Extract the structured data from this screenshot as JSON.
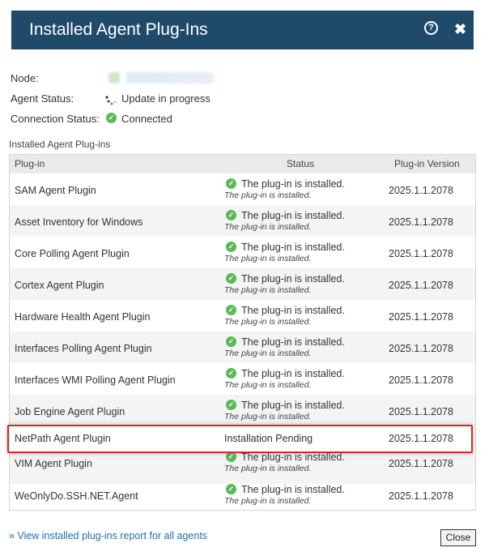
{
  "dialog": {
    "title": "Installed Agent Plug-Ins",
    "help_glyph": "?",
    "close_glyph": "✖"
  },
  "info": {
    "node_label": "Node:",
    "agent_status_label": "Agent Status:",
    "agent_status_value": "Update in progress",
    "connection_status_label": "Connection Status:",
    "connection_status_value": "Connected"
  },
  "section_label": "Installed Agent Plug-ins",
  "table": {
    "headers": [
      "Plug-in",
      "Status",
      "Plug-in Version"
    ],
    "rows": [
      {
        "name": "SAM Agent Plugin",
        "status": "The plug-in is installed.",
        "detail": "The plug-in is installed.",
        "version": "2025.1.1.2078"
      },
      {
        "name": "Asset Inventory for Windows",
        "status": "The plug-in is installed.",
        "detail": "The plug-in is installed.",
        "version": "2025.1.1.2078"
      },
      {
        "name": "Core Polling Agent Plugin",
        "status": "The plug-in is installed.",
        "detail": "The plug-in is installed.",
        "version": "2025.1.1.2078"
      },
      {
        "name": "Cortex Agent Plugin",
        "status": "The plug-in is installed.",
        "detail": "The plug-in is installed.",
        "version": "2025.1.1.2078"
      },
      {
        "name": "Hardware Health Agent Plugin",
        "status": "The plug-in is installed.",
        "detail": "The plug-in is installed.",
        "version": "2025.1.1.2078"
      },
      {
        "name": "Interfaces Polling Agent Plugin",
        "status": "The plug-in is installed.",
        "detail": "The plug-in is installed.",
        "version": "2025.1.1.2078"
      },
      {
        "name": "Interfaces WMI Polling Agent Plugin",
        "status": "The plug-in is installed.",
        "detail": "The plug-in is installed.",
        "version": "2025.1.1.2078"
      },
      {
        "name": "Job Engine Agent Plugin",
        "status": "The plug-in is installed.",
        "detail": "The plug-in is installed.",
        "version": "2025.1.1.2078"
      },
      {
        "name": "NetPath Agent Plugin",
        "status": "Installation Pending",
        "detail": "",
        "version": "2025.1.1.2078"
      },
      {
        "name": "VIM Agent Plugin",
        "status": "The plug-in is installed.",
        "detail": "The plug-in is installed.",
        "version": "2025.1.1.2078"
      },
      {
        "name": "WeOnlyDo.SSH.NET.Agent",
        "status": "The plug-in is installed.",
        "detail": "The plug-in is installed.",
        "version": "2025.1.1.2078"
      }
    ]
  },
  "footer": {
    "report_link": "» View installed plug-ins report for all agents",
    "close_label": "Close"
  },
  "colors": {
    "titlebar": "#204a69",
    "ok_green": "#5cb85c",
    "highlight_red": "#d42a2a",
    "link_blue": "#1f6fb0"
  }
}
